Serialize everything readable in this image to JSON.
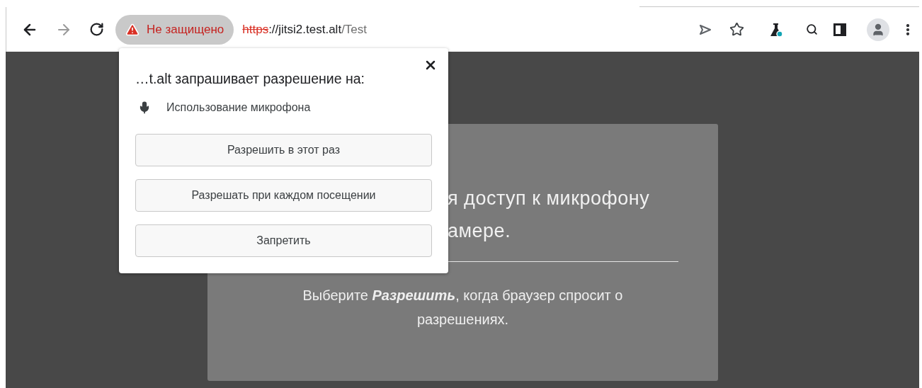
{
  "toolbar": {
    "security_chip": {
      "label": "Не защищено"
    },
    "url": {
      "scheme": "https",
      "host": "://jitsi2.test.alt",
      "path": "/Test"
    }
  },
  "permission_popup": {
    "title": "…t.alt запрашивает разрешение на:",
    "permission": "Использование микрофона",
    "buttons": [
      "Разрешить в этот раз",
      "Разрешать при каждом посещении",
      "Запретить"
    ]
  },
  "card": {
    "heading_lines": [
      "я доступ к микрофону",
      "амере."
    ],
    "hint": "Выберите **Разрешить**, когда браузер спросит о разрешениях."
  }
}
